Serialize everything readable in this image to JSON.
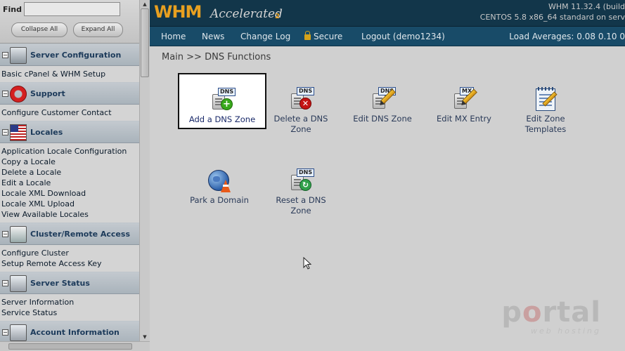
{
  "sidebar": {
    "find_label": "Find",
    "collapse_all": "Collapse All",
    "expand_all": "Expand All",
    "sections": [
      {
        "title": "Server Configuration",
        "icon": "server-config-icon",
        "items": [
          "Basic cPanel & WHM Setup"
        ]
      },
      {
        "title": "Support",
        "icon": "lifebuoy-icon",
        "items": [
          "Configure Customer Contact"
        ]
      },
      {
        "title": "Locales",
        "icon": "flag-icon",
        "items": [
          "Application Locale Configuration",
          "Copy a Locale",
          "Delete a Locale",
          "Edit a Locale",
          "Locale XML Download",
          "Locale XML Upload",
          "View Available Locales"
        ]
      },
      {
        "title": "Cluster/Remote Access",
        "icon": "cluster-icon",
        "items": [
          "Configure Cluster",
          "Setup Remote Access Key"
        ]
      },
      {
        "title": "Server Status",
        "icon": "server-status-icon",
        "items": [
          "Server Information",
          "Service Status"
        ]
      },
      {
        "title": "Account Information",
        "icon": "account-info-icon",
        "items": []
      }
    ]
  },
  "header": {
    "logo_main": "WHM",
    "logo_sub": "Accelerated",
    "logo_num": "2",
    "version_line1": "WHM 11.32.4 (build",
    "version_line2": "CENTOS 5.8 x86_64 standard on serv"
  },
  "nav": {
    "home": "Home",
    "news": "News",
    "changelog": "Change Log",
    "secure": "Secure",
    "logout": "Logout (demo1234)",
    "load_avg": "Load Averages: 0.08 0.10 0"
  },
  "breadcrumb": "Main >> DNS Functions",
  "functions": {
    "add_dns": "Add a DNS Zone",
    "delete_dns_1": "Delete a DNS",
    "delete_dns_2": "Zone",
    "edit_dns": "Edit DNS Zone",
    "edit_mx": "Edit MX Entry",
    "edit_templates_1": "Edit Zone",
    "edit_templates_2": "Templates",
    "park_domain": "Park a Domain",
    "reset_dns_1": "Reset a DNS",
    "reset_dns_2": "Zone"
  },
  "icon_tags": {
    "dns": "DNS",
    "mx": "MX"
  },
  "watermark": {
    "main_1": "p",
    "main_o": "o",
    "main_2": "rtal",
    "sub": "web hosting"
  }
}
